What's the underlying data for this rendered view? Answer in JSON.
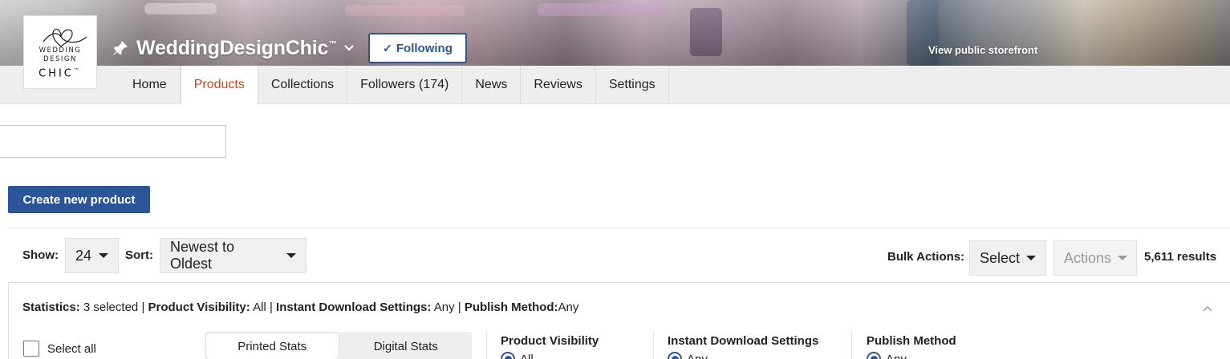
{
  "store": {
    "logo_line1": "WEDDING",
    "logo_line2": "DESIGN",
    "logo_line3": "CHIC",
    "logo_tm": "™",
    "name": "WeddingDesignChic",
    "tm": "™",
    "follow_label": "Following",
    "view_public": "View public storefront"
  },
  "nav": {
    "tabs": [
      {
        "label": "Home"
      },
      {
        "label": "Products"
      },
      {
        "label": "Collections"
      },
      {
        "label": "Followers (174)"
      },
      {
        "label": "News"
      },
      {
        "label": "Reviews"
      },
      {
        "label": "Settings"
      }
    ],
    "active": "Products"
  },
  "search": {
    "value": "",
    "placeholder": ""
  },
  "create_button": "Create new product",
  "toolbar": {
    "show_label": "Show:",
    "show_value": "24",
    "sort_label": "Sort:",
    "sort_value": "Newest to Oldest",
    "bulk_label": "Bulk Actions:",
    "bulk_select": "Select",
    "actions": "Actions",
    "results": "5,611 results"
  },
  "stats": {
    "statistics_label": "Statistics:",
    "statistics_value": "3 selected",
    "visibility_label": "Product Visibility:",
    "visibility_value": "All",
    "download_label": "Instant Download Settings:",
    "download_value": "Any",
    "publish_label": "Publish Method:",
    "publish_value": "Any",
    "sep": "|"
  },
  "panel": {
    "select_all": "Select all",
    "seg_printed": "Printed Stats",
    "seg_digital": "Digital Stats",
    "filters": [
      {
        "title": "Product Visibility",
        "option": "All"
      },
      {
        "title": "Instant Download Settings",
        "option": "Any"
      },
      {
        "title": "Publish Method",
        "option": "Any"
      }
    ]
  },
  "colors": {
    "accent": "#2a5596",
    "active_tab": "#c44a1a",
    "nav_bg": "#eeeeee"
  }
}
